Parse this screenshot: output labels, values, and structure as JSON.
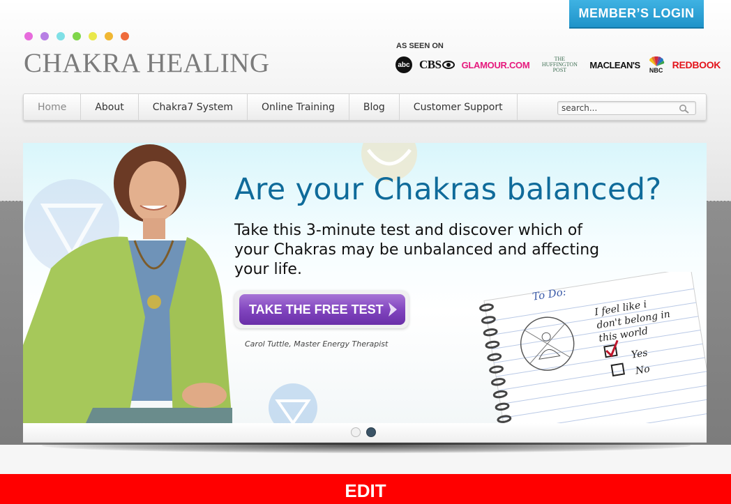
{
  "header": {
    "login_label": "MEMBER’S LOGIN",
    "logo_text": "CHAKRA HEALING",
    "dot_colors": [
      "#e76bdc",
      "#b77fe4",
      "#7fe0e6",
      "#7fd64a",
      "#e9e84a",
      "#f0b733",
      "#ef6b3b"
    ],
    "as_seen_on_label": "AS SEEN ON",
    "media": {
      "abc": "abc",
      "cbs": "CBS",
      "glamour": "GLAMOUR.COM",
      "huffington_line1": "THE",
      "huffington_line2": "HUFFINGTON",
      "huffington_line3": "POST",
      "macleans": "MACLEAN'S",
      "nbc": "NBC",
      "redbook": "REDBOOK"
    }
  },
  "nav": {
    "items": [
      {
        "label": "Home",
        "active": true
      },
      {
        "label": "About"
      },
      {
        "label": "Chakra7 System"
      },
      {
        "label": "Online Training"
      },
      {
        "label": "Blog"
      },
      {
        "label": "Customer Support"
      }
    ],
    "search_placeholder": "search..."
  },
  "hero": {
    "headline": "Are your Chakras balanced?",
    "subtext": "Take this 3-minute test and discover which of your Chakras may be unbalanced and affecting your life.",
    "cta_label": "TAKE THE FREE TEST",
    "caption": "Carol Tuttle, Master Energy Therapist",
    "notebook": {
      "todo": "To Do:",
      "line1": "I feel like i",
      "line2": "don't belong in",
      "line3": "this world",
      "yes": "Yes",
      "no": "No"
    },
    "slides": {
      "count": 2,
      "active": 2
    }
  },
  "edit_label": "EDIT",
  "colors": {
    "login_bg": "#2aa3d8",
    "headline": "#0f6b9a",
    "cta": "#7f43bd",
    "edit_bar": "#ff0000"
  }
}
